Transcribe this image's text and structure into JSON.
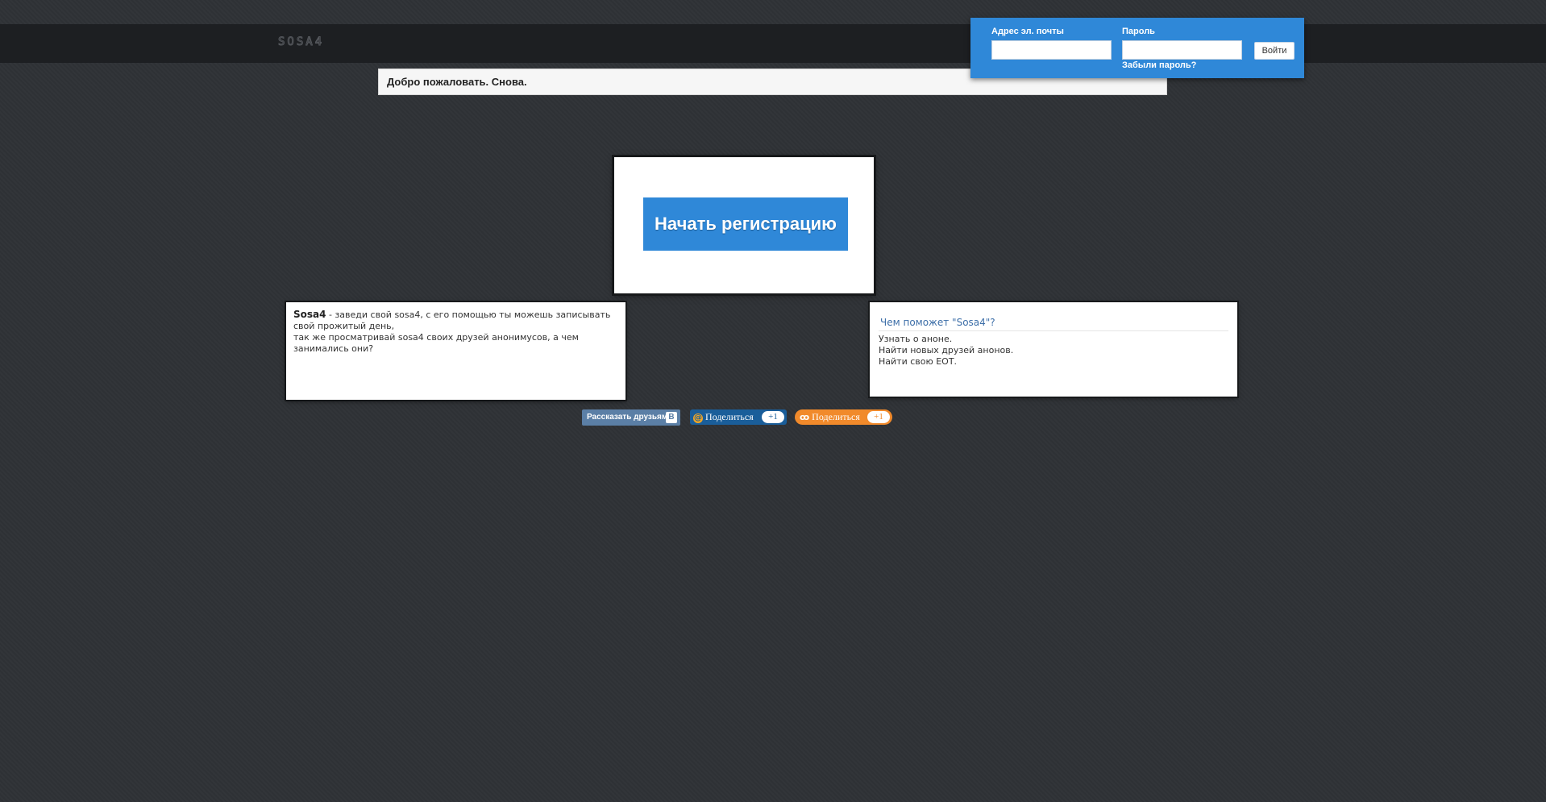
{
  "header": {
    "logo_text": "sosa4"
  },
  "welcome": {
    "text": "Добро пожаловать. Снова."
  },
  "login": {
    "email_label": "Адрес эл. почты",
    "email_value": "",
    "password_label": "Пароль",
    "password_value": "",
    "submit_label": "Войти",
    "forgot_label": "Забыли пароль?"
  },
  "cta": {
    "label": "Начать регистрацию"
  },
  "about": {
    "brand": "Sosa4",
    "line1": " - заведи свой sosa4, с его помощью ты можешь записывать свой прожитый день,",
    "line2": "так же просматривай sosa4 своих друзей анонимусов, а чем занимались они?"
  },
  "features": {
    "title": "Чем поможет \"Sosa4\"?",
    "items": [
      "Узнать о аноне.",
      "Найти новых друзей анонов.",
      "Найти свою ЕОТ."
    ]
  },
  "share": {
    "vk_label": "Рассказать друзьям",
    "vk_badge": "В",
    "mail_icon": "@",
    "mail_label": "Поделиться",
    "mail_count": "+1",
    "ok_icon": "ok",
    "ok_label": "Поделиться",
    "ok_count": "+1"
  },
  "colors": {
    "accent": "#2f88d8",
    "background": "#2f3236",
    "vk": "#5b7fa6",
    "mail": "#1a5e9a",
    "ok": "#f18a2b"
  }
}
